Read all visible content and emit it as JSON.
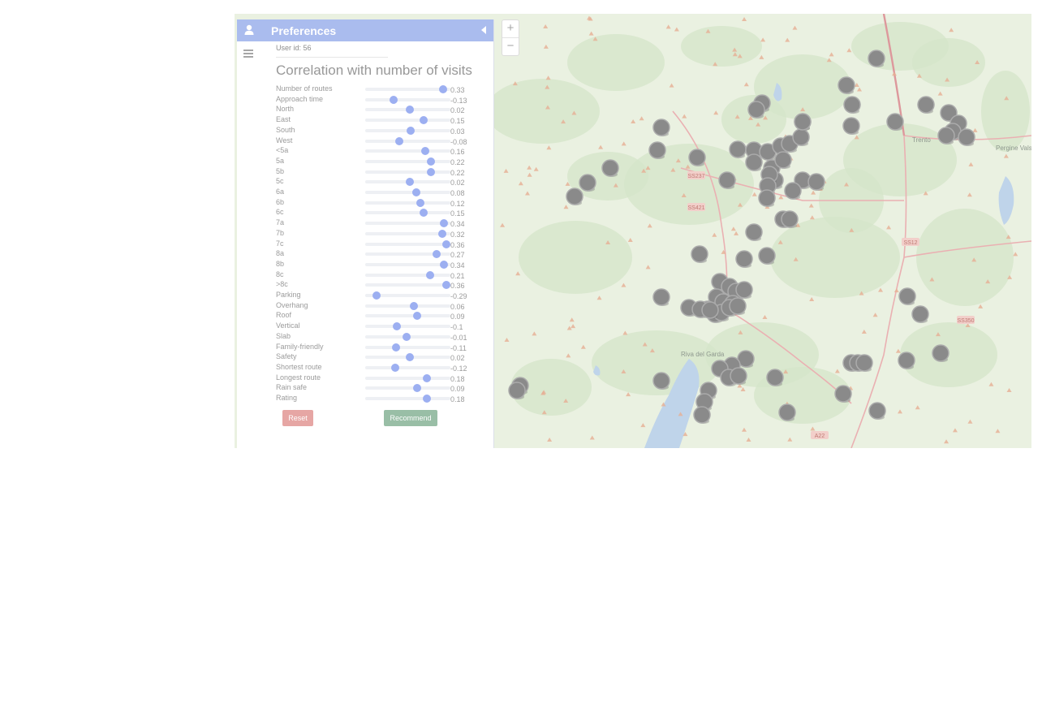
{
  "panel": {
    "title": "Preferences",
    "user_label": "User id:",
    "user_id": "56",
    "heading": "Correlation with number of visits",
    "rows": [
      {
        "label": "Number of routes",
        "value": "0.33",
        "corr": 0.33
      },
      {
        "label": "Approach time",
        "value": "-0.13",
        "corr": -0.13
      },
      {
        "label": "North",
        "value": "0.02",
        "corr": 0.02
      },
      {
        "label": "East",
        "value": "0.15",
        "corr": 0.15
      },
      {
        "label": "South",
        "value": "0.03",
        "corr": 0.03
      },
      {
        "label": "West",
        "value": "-0.08",
        "corr": -0.08
      },
      {
        "label": "<5a",
        "value": "0.16",
        "corr": 0.16
      },
      {
        "label": "5a",
        "value": "0.22",
        "corr": 0.22
      },
      {
        "label": "5b",
        "value": "0.22",
        "corr": 0.22
      },
      {
        "label": "5c",
        "value": "0.02",
        "corr": 0.02
      },
      {
        "label": "6a",
        "value": "0.08",
        "corr": 0.08
      },
      {
        "label": "6b",
        "value": "0.12",
        "corr": 0.12
      },
      {
        "label": "6c",
        "value": "0.15",
        "corr": 0.15
      },
      {
        "label": "7a",
        "value": "0.34",
        "corr": 0.34
      },
      {
        "label": "7b",
        "value": "0.32",
        "corr": 0.32
      },
      {
        "label": "7c",
        "value": "0.36",
        "corr": 0.36
      },
      {
        "label": "8a",
        "value": "0.27",
        "corr": 0.27
      },
      {
        "label": "8b",
        "value": "0.34",
        "corr": 0.34
      },
      {
        "label": "8c",
        "value": "0.21",
        "corr": 0.21
      },
      {
        "label": ">8c",
        "value": "0.36",
        "corr": 0.36
      },
      {
        "label": "Parking",
        "value": "-0.29",
        "corr": -0.29
      },
      {
        "label": "Overhang",
        "value": "0.06",
        "corr": 0.06
      },
      {
        "label": "Roof",
        "value": "0.09",
        "corr": 0.09
      },
      {
        "label": "Vertical",
        "value": "-0.1",
        "corr": -0.1
      },
      {
        "label": "Slab",
        "value": "-0.01",
        "corr": -0.01
      },
      {
        "label": "Family-friendly",
        "value": "-0.11",
        "corr": -0.11
      },
      {
        "label": "Safety",
        "value": "0.02",
        "corr": 0.02
      },
      {
        "label": "Shortest route",
        "value": "-0.12",
        "corr": -0.12
      },
      {
        "label": "Longest route",
        "value": "0.18",
        "corr": 0.18
      },
      {
        "label": "Rain safe",
        "value": "0.09",
        "corr": 0.09
      },
      {
        "label": "Rating",
        "value": "0.18",
        "corr": 0.18
      }
    ],
    "reset_label": "Reset",
    "recommend_label": "Recommend"
  },
  "map": {
    "zoom_in": "+",
    "zoom_out": "−",
    "towns": [
      "Trento",
      "Riva del Garda",
      "Pergine Valsugana"
    ],
    "roads": [
      "SS237",
      "SS421",
      "SS12",
      "SS350",
      "A22"
    ]
  },
  "colors": {
    "header": "#9fb3ec",
    "knob": "#8fa4f0",
    "reset": "#e39a98",
    "recommend": "#8bb59a",
    "marker": "#7a7a7a",
    "land": "#e7efdd",
    "forest": "#cfe2c1",
    "water": "#b7cfe8"
  }
}
